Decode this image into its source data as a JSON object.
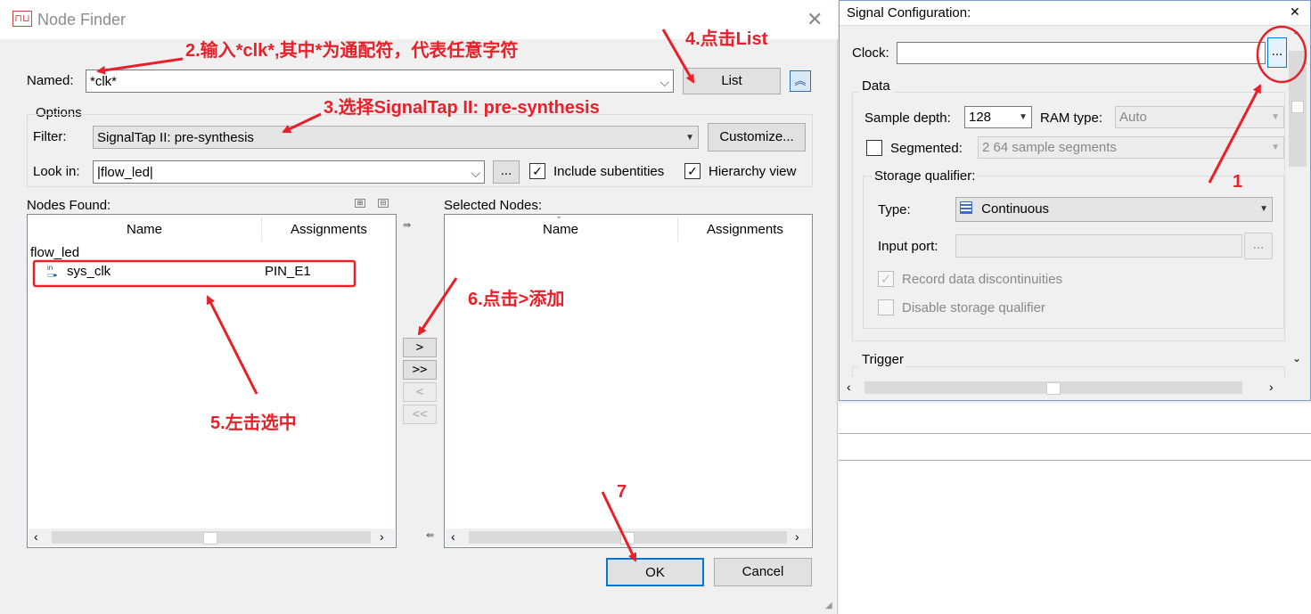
{
  "node_finder": {
    "title": "Node Finder",
    "named_label": "Named:",
    "named_value": "*clk*",
    "list_button": "List",
    "options_label": "Options",
    "filter_label": "Filter:",
    "filter_value": "SignalTap II: pre-synthesis",
    "customize_button": "Customize...",
    "lookin_label": "Look in:",
    "lookin_value": "|flow_led|",
    "browse_button": "...",
    "include_subentities": "Include subentities",
    "hierarchy_view": "Hierarchy view",
    "nodes_found_label": "Nodes Found:",
    "selected_nodes_label": "Selected Nodes:",
    "col_name": "Name",
    "col_assignments": "Assignments",
    "tree_root": "flow_led",
    "node": {
      "name": "sys_clk",
      "assignment": "PIN_E1",
      "pin_icon_text": "in"
    },
    "move_buttons": [
      ">",
      ">>",
      "<",
      "<<"
    ],
    "ok_button": "OK",
    "cancel_button": "Cancel"
  },
  "signal_config": {
    "title": "Signal Configuration:",
    "clock_label": "Clock:",
    "clock_value": "",
    "clock_browse": "...",
    "data_label": "Data",
    "sample_depth_label": "Sample depth:",
    "sample_depth_value": "128",
    "ram_type_label": "RAM type:",
    "ram_type_value": "Auto",
    "segmented_label": "Segmented:",
    "segmented_value": "2  64 sample segments",
    "storage_qualifier_label": "Storage qualifier:",
    "type_label": "Type:",
    "type_value": "Continuous",
    "input_port_label": "Input port:",
    "input_port_browse": "...",
    "record_discontinuities": "Record data discontinuities",
    "disable_storage_qualifier": "Disable storage qualifier",
    "trigger_label": "Trigger"
  },
  "annotations": {
    "step2": "2.输入*clk*,其中*为通配符，代表任意字符",
    "step3": "3.选择SignalTap II: pre-synthesis",
    "step4": "4.点击List",
    "step5": "5.左击选中",
    "step6": "6.点击>添加",
    "step7": "7",
    "step1": "1"
  },
  "colors": {
    "annotation_red": "#e8202a",
    "ok_border": "#0078d7"
  }
}
